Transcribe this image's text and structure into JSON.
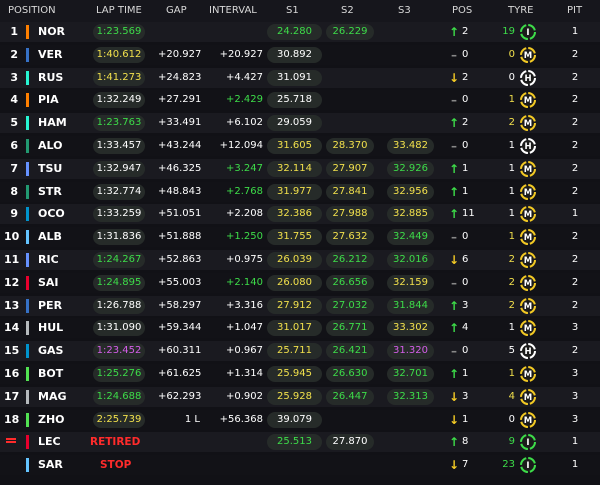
{
  "header": {
    "position": "POSITION",
    "lap_time": "LAP TIME",
    "gap": "GAP",
    "interval": "INTERVAL",
    "s1": "S1",
    "s2": "S2",
    "s3": "S3",
    "pos": "POS",
    "tyre": "TYRE",
    "pit": "PIT"
  },
  "colors": {
    "purple": "#d45ee9",
    "green": "#3ddc49",
    "yellow": "#f1e04c",
    "white": "#ffffff",
    "red": "#ff2b2b",
    "soft": "#e5202a",
    "medium": "#f2c924",
    "hard": "#ffffff",
    "intermediate": "#3ddc49"
  },
  "tyres": {
    "M": "M",
    "H": "H",
    "I": "I"
  },
  "rows": [
    {
      "pos": "1",
      "code": "NOR",
      "team": "#ff8000",
      "lap": "1:23.569",
      "lap_c": "green",
      "gap": "",
      "intv": "",
      "s1": "24.280",
      "s1_c": "green",
      "s2": "26.229",
      "s2_c": "green",
      "s3": "",
      "s3_c": "white",
      "dir": "up",
      "pchg": "2",
      "tlaps": "19",
      "tlaps_c": "green",
      "tyre": "I",
      "pit": "1"
    },
    {
      "pos": "2",
      "code": "VER",
      "team": "#3671c6",
      "lap": "1:40.612",
      "lap_c": "yellow",
      "gap": "+20.927",
      "intv": "+20.927",
      "intv_c": "white",
      "s1": "30.892",
      "s1_c": "white",
      "s2": "",
      "s2_c": "white",
      "s3": "",
      "s3_c": "white",
      "dir": "none",
      "pchg": "0",
      "tlaps": "0",
      "tlaps_c": "yellow",
      "tyre": "M",
      "pit": "2"
    },
    {
      "pos": "3",
      "code": "RUS",
      "team": "#27f4d2",
      "lap": "1:41.273",
      "lap_c": "yellow",
      "gap": "+24.823",
      "intv": "+4.427",
      "intv_c": "white",
      "s1": "31.091",
      "s1_c": "white",
      "s2": "",
      "s2_c": "white",
      "s3": "",
      "s3_c": "white",
      "dir": "down",
      "pchg": "2",
      "tlaps": "0",
      "tlaps_c": "white",
      "tyre": "H",
      "pit": "2"
    },
    {
      "pos": "4",
      "code": "PIA",
      "team": "#ff8000",
      "lap": "1:32.249",
      "lap_c": "white",
      "gap": "+27.291",
      "intv": "+2.429",
      "intv_c": "green",
      "s1": "25.718",
      "s1_c": "white",
      "s2": "",
      "s2_c": "white",
      "s3": "",
      "s3_c": "white",
      "dir": "none",
      "pchg": "0",
      "tlaps": "1",
      "tlaps_c": "yellow",
      "tyre": "M",
      "pit": "2"
    },
    {
      "pos": "5",
      "code": "HAM",
      "team": "#27f4d2",
      "lap": "1:23.763",
      "lap_c": "green",
      "gap": "+33.491",
      "intv": "+6.102",
      "intv_c": "white",
      "s1": "29.059",
      "s1_c": "white",
      "s2": "",
      "s2_c": "white",
      "s3": "",
      "s3_c": "white",
      "dir": "up",
      "pchg": "2",
      "tlaps": "2",
      "tlaps_c": "yellow",
      "tyre": "M",
      "pit": "2"
    },
    {
      "pos": "6",
      "code": "ALO",
      "team": "#229971",
      "lap": "1:33.457",
      "lap_c": "white",
      "gap": "+43.244",
      "intv": "+12.094",
      "intv_c": "white",
      "s1": "31.605",
      "s1_c": "yellow",
      "s2": "28.370",
      "s2_c": "yellow",
      "s3": "33.482",
      "s3_c": "yellow",
      "dir": "none",
      "pchg": "0",
      "tlaps": "1",
      "tlaps_c": "white",
      "tyre": "H",
      "pit": "2"
    },
    {
      "pos": "7",
      "code": "TSU",
      "team": "#6692ff",
      "lap": "1:32.947",
      "lap_c": "white",
      "gap": "+46.325",
      "intv": "+3.247",
      "intv_c": "green",
      "s1": "32.114",
      "s1_c": "yellow",
      "s2": "27.907",
      "s2_c": "yellow",
      "s3": "32.926",
      "s3_c": "green",
      "dir": "up",
      "pchg": "1",
      "tlaps": "1",
      "tlaps_c": "white",
      "tyre": "M",
      "pit": "2"
    },
    {
      "pos": "8",
      "code": "STR",
      "team": "#229971",
      "lap": "1:32.774",
      "lap_c": "white",
      "gap": "+48.843",
      "intv": "+2.768",
      "intv_c": "green",
      "s1": "31.977",
      "s1_c": "yellow",
      "s2": "27.841",
      "s2_c": "yellow",
      "s3": "32.956",
      "s3_c": "yellow",
      "dir": "up",
      "pchg": "1",
      "tlaps": "1",
      "tlaps_c": "white",
      "tyre": "M",
      "pit": "2"
    },
    {
      "pos": "9",
      "code": "OCO",
      "team": "#0093cc",
      "lap": "1:33.259",
      "lap_c": "white",
      "gap": "+51.051",
      "intv": "+2.208",
      "intv_c": "white",
      "s1": "32.386",
      "s1_c": "yellow",
      "s2": "27.988",
      "s2_c": "yellow",
      "s3": "32.885",
      "s3_c": "yellow",
      "dir": "up",
      "pchg": "11",
      "tlaps": "1",
      "tlaps_c": "white",
      "tyre": "M",
      "pit": "1"
    },
    {
      "pos": "10",
      "code": "ALB",
      "team": "#64c4ff",
      "lap": "1:31.836",
      "lap_c": "white",
      "gap": "+51.888",
      "intv": "+1.250",
      "intv_c": "green",
      "s1": "31.755",
      "s1_c": "yellow",
      "s2": "27.632",
      "s2_c": "yellow",
      "s3": "32.449",
      "s3_c": "green",
      "dir": "none",
      "pchg": "0",
      "tlaps": "1",
      "tlaps_c": "yellow",
      "tyre": "M",
      "pit": "2"
    },
    {
      "pos": "11",
      "code": "RIC",
      "team": "#6692ff",
      "lap": "1:24.267",
      "lap_c": "green",
      "gap": "+52.863",
      "intv": "+0.975",
      "intv_c": "white",
      "s1": "26.039",
      "s1_c": "yellow",
      "s2": "26.212",
      "s2_c": "green",
      "s3": "32.016",
      "s3_c": "green",
      "dir": "down",
      "pchg": "6",
      "tlaps": "2",
      "tlaps_c": "yellow",
      "tyre": "M",
      "pit": "2"
    },
    {
      "pos": "12",
      "code": "SAI",
      "team": "#e8002d",
      "lap": "1:24.895",
      "lap_c": "green",
      "gap": "+55.003",
      "intv": "+2.140",
      "intv_c": "green",
      "s1": "26.080",
      "s1_c": "yellow",
      "s2": "26.656",
      "s2_c": "green",
      "s3": "32.159",
      "s3_c": "yellow",
      "dir": "none",
      "pchg": "0",
      "tlaps": "2",
      "tlaps_c": "yellow",
      "tyre": "M",
      "pit": "2"
    },
    {
      "pos": "13",
      "code": "PER",
      "team": "#3671c6",
      "lap": "1:26.788",
      "lap_c": "white",
      "gap": "+58.297",
      "intv": "+3.316",
      "intv_c": "white",
      "s1": "27.912",
      "s1_c": "yellow",
      "s2": "27.032",
      "s2_c": "green",
      "s3": "31.844",
      "s3_c": "green",
      "dir": "up",
      "pchg": "3",
      "tlaps": "2",
      "tlaps_c": "yellow",
      "tyre": "M",
      "pit": "2"
    },
    {
      "pos": "14",
      "code": "HUL",
      "team": "#b6babd",
      "lap": "1:31.090",
      "lap_c": "white",
      "gap": "+59.344",
      "intv": "+1.047",
      "intv_c": "white",
      "s1": "31.017",
      "s1_c": "yellow",
      "s2": "26.771",
      "s2_c": "green",
      "s3": "33.302",
      "s3_c": "yellow",
      "dir": "up",
      "pchg": "4",
      "tlaps": "1",
      "tlaps_c": "white",
      "tyre": "M",
      "pit": "3"
    },
    {
      "pos": "15",
      "code": "GAS",
      "team": "#0093cc",
      "lap": "1:23.452",
      "lap_c": "purple",
      "gap": "+60.311",
      "intv": "+0.967",
      "intv_c": "white",
      "s1": "25.711",
      "s1_c": "yellow",
      "s2": "26.421",
      "s2_c": "green",
      "s3": "31.320",
      "s3_c": "purple",
      "dir": "none",
      "pchg": "0",
      "tlaps": "5",
      "tlaps_c": "white",
      "tyre": "H",
      "pit": "2"
    },
    {
      "pos": "16",
      "code": "BOT",
      "team": "#52e252",
      "lap": "1:25.276",
      "lap_c": "green",
      "gap": "+61.625",
      "intv": "+1.314",
      "intv_c": "white",
      "s1": "25.945",
      "s1_c": "yellow",
      "s2": "26.630",
      "s2_c": "green",
      "s3": "32.701",
      "s3_c": "green",
      "dir": "up",
      "pchg": "1",
      "tlaps": "1",
      "tlaps_c": "yellow",
      "tyre": "M",
      "pit": "3"
    },
    {
      "pos": "17",
      "code": "MAG",
      "team": "#b6babd",
      "lap": "1:24.688",
      "lap_c": "green",
      "gap": "+62.293",
      "intv": "+0.902",
      "intv_c": "white",
      "s1": "25.928",
      "s1_c": "yellow",
      "s2": "26.447",
      "s2_c": "green",
      "s3": "32.313",
      "s3_c": "green",
      "dir": "down",
      "pchg": "3",
      "tlaps": "4",
      "tlaps_c": "yellow",
      "tyre": "M",
      "pit": "3"
    },
    {
      "pos": "18",
      "code": "ZHO",
      "team": "#52e252",
      "lap": "2:25.739",
      "lap_c": "yellow",
      "gap": "1 L",
      "intv": "+56.368",
      "intv_c": "white",
      "s1": "39.079",
      "s1_c": "white",
      "s2": "",
      "s2_c": "white",
      "s3": "",
      "s3_c": "white",
      "dir": "down",
      "pchg": "1",
      "tlaps": "0",
      "tlaps_c": "white",
      "tyre": "M",
      "pit": "3"
    }
  ],
  "out_rows": [
    {
      "code": "LEC",
      "team": "#e8002d",
      "status": "RETIRED",
      "s1": "25.513",
      "s1_c": "green",
      "s2": "27.870",
      "s2_c": "white",
      "dir": "up",
      "pchg": "8",
      "tlaps": "9",
      "tlaps_c": "green",
      "tyre": "I",
      "pit": "1",
      "flag": true
    },
    {
      "code": "SAR",
      "team": "#64c4ff",
      "status": "STOP",
      "dir": "down",
      "pchg": "7",
      "tlaps": "23",
      "tlaps_c": "green",
      "tyre": "I",
      "pit": "1",
      "flag": false
    }
  ]
}
